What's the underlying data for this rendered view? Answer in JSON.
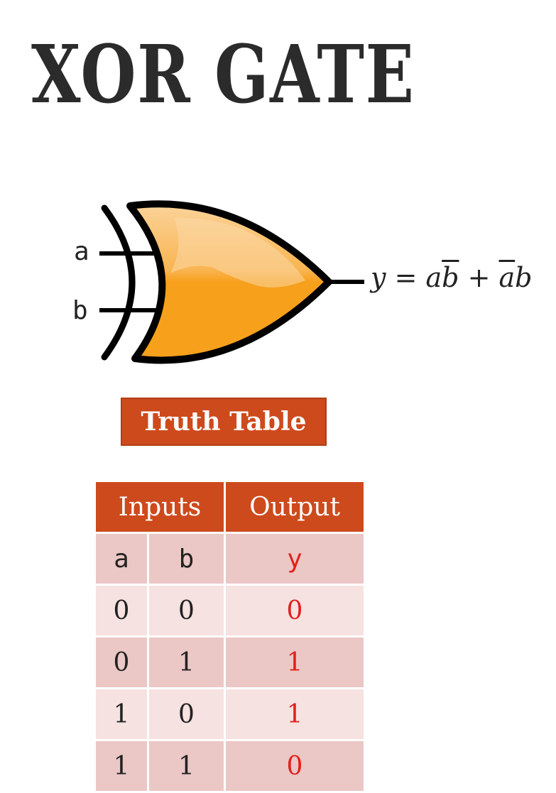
{
  "title": "XOR GATE",
  "gate": {
    "input_a": "a",
    "input_b": "b",
    "fill_color": "#f7a01c",
    "equation": {
      "lhs": "y",
      "equals": "=",
      "t1_var": "a",
      "t1_bar": "b",
      "plus": "+",
      "t2_bar": "a",
      "t2_var": "b"
    }
  },
  "truth_table_label": "Truth Table",
  "table": {
    "header_inputs": "Inputs",
    "header_output": "Output",
    "rows": [
      {
        "a": "a",
        "b": "b",
        "y": "y"
      },
      {
        "a": "0",
        "b": "0",
        "y": "0"
      },
      {
        "a": "0",
        "b": "1",
        "y": "1"
      },
      {
        "a": "1",
        "b": "0",
        "y": "1"
      },
      {
        "a": "1",
        "b": "1",
        "y": "0"
      }
    ]
  },
  "colors": {
    "header": "#cd4a1d",
    "row_dark": "#ebc7c5",
    "row_light": "#f5e2e1",
    "output_text": "#e3201b"
  }
}
